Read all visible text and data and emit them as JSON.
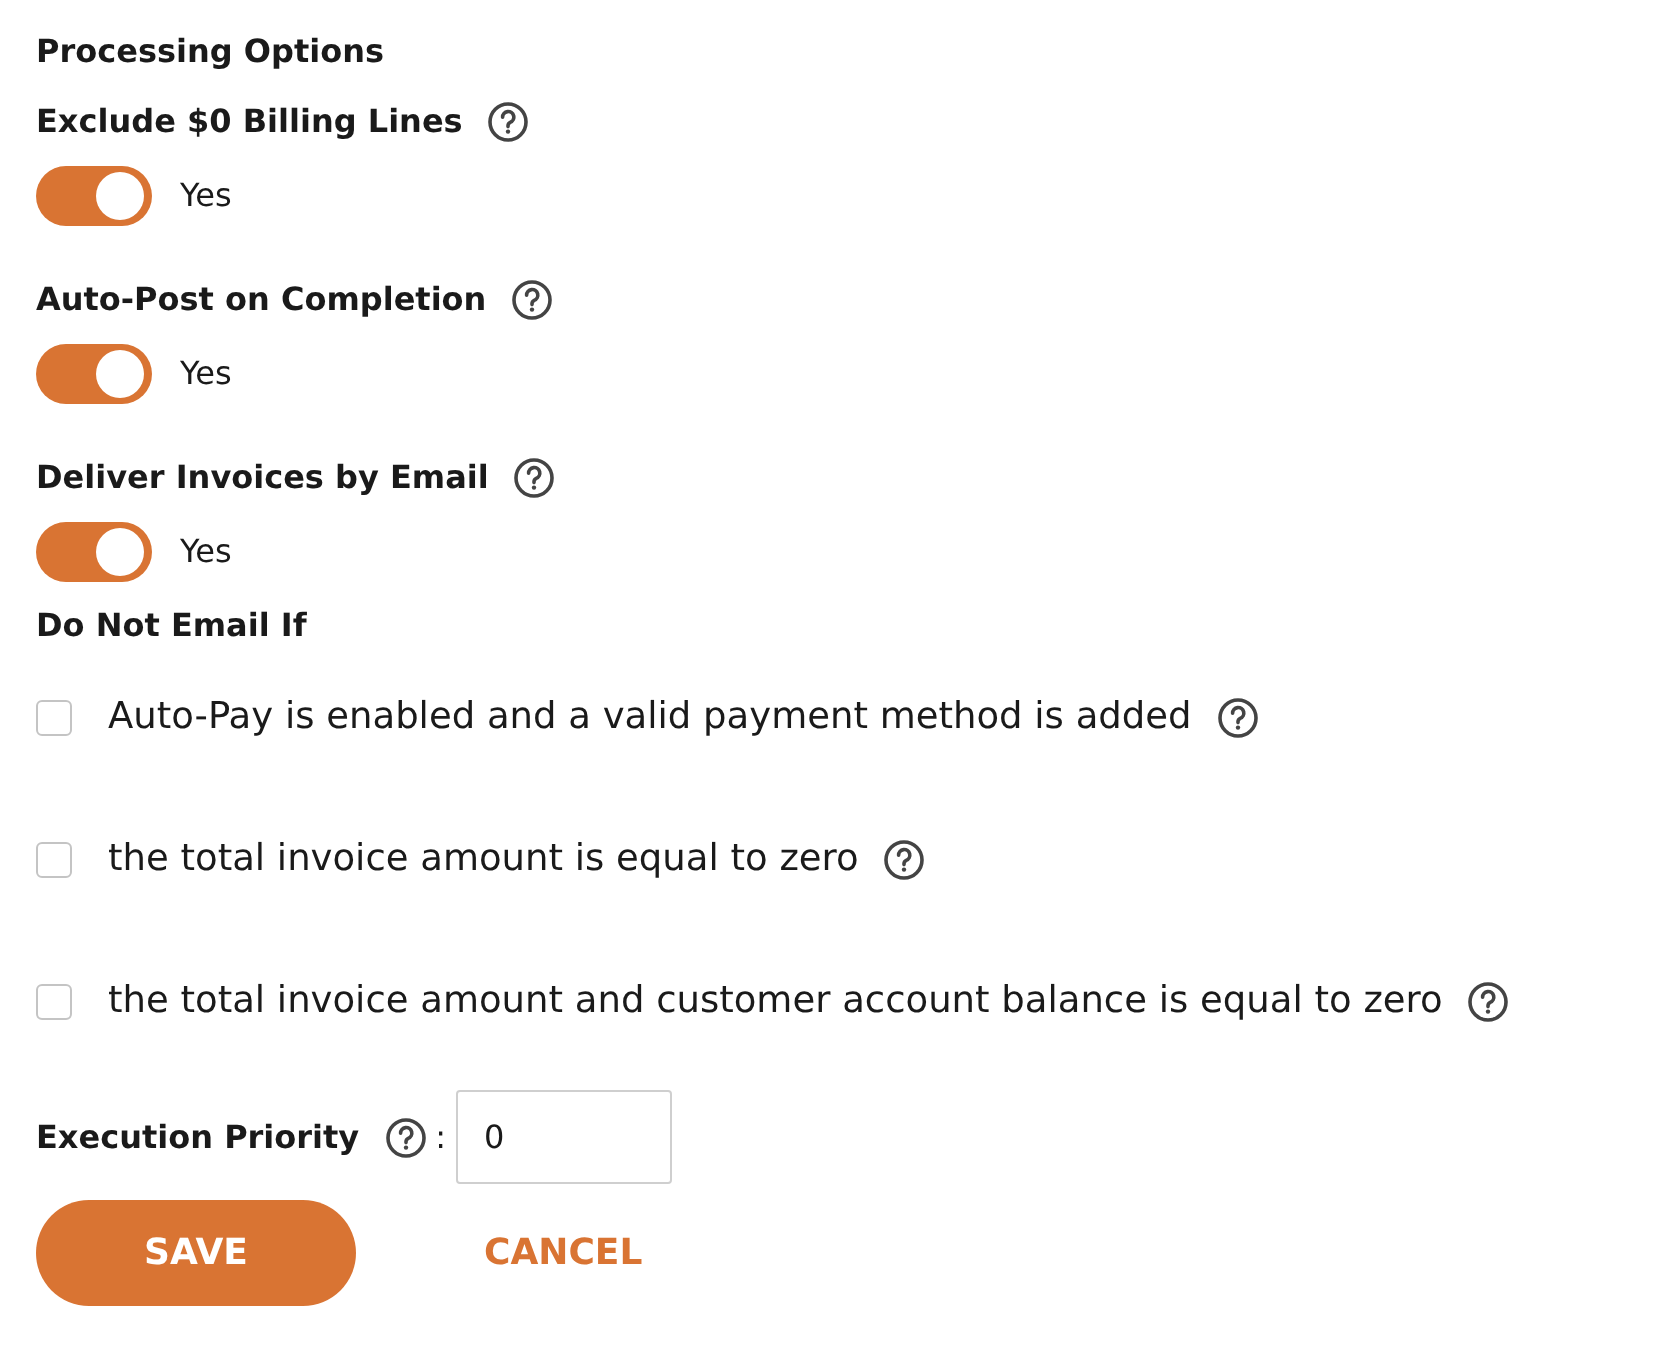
{
  "title": "Processing Options",
  "toggles": [
    {
      "label": "Exclude $0 Billing Lines",
      "on": true,
      "value_label": "Yes"
    },
    {
      "label": "Auto-Post on Completion",
      "on": true,
      "value_label": "Yes"
    },
    {
      "label": "Deliver Invoices by Email",
      "on": true,
      "value_label": "Yes"
    }
  ],
  "do_not_email": {
    "heading": "Do Not Email If",
    "options": [
      {
        "label": "Auto-Pay is enabled and a valid payment method is added",
        "checked": false
      },
      {
        "label": "the total invoice amount is equal to zero",
        "checked": false
      },
      {
        "label": "the total invoice amount and customer account balance is equal to zero",
        "checked": false
      }
    ]
  },
  "execution_priority": {
    "label": "Execution Priority",
    "separator": ":",
    "value": "0"
  },
  "buttons": [
    {
      "label": "SAVE",
      "kind": "primary"
    },
    {
      "label": "CANCEL",
      "kind": "link"
    }
  ]
}
